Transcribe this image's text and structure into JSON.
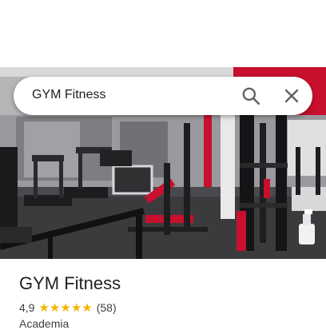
{
  "search": {
    "query": "GYM Fitness"
  },
  "place": {
    "name": "GYM Fitness",
    "rating": "4,9",
    "stars": 5,
    "review_count": "(58)",
    "category": "Academia"
  },
  "photo": {
    "subject": "gym interior with treadmills and weight machines"
  },
  "icons": {
    "search": "search-icon",
    "close": "close-icon",
    "star": "star-icon"
  },
  "colors": {
    "star": "#f5b400",
    "accent_red": "#c8102e",
    "text_primary": "#202124",
    "text_secondary": "#3c4043"
  }
}
